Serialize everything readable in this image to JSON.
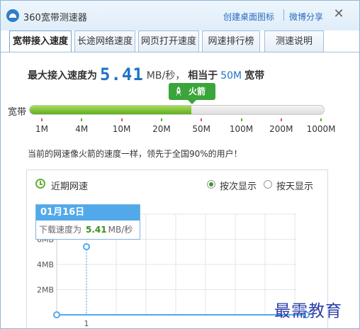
{
  "window": {
    "title": "360宽带测速器",
    "links": {
      "create_icon": "创建桌面图标",
      "share": "微博分享"
    },
    "close_icon": "close-icon"
  },
  "tabs": [
    {
      "label": "宽带接入速度",
      "active": true
    },
    {
      "label": "长途网络速度",
      "active": false
    },
    {
      "label": "网页打开速度",
      "active": false
    },
    {
      "label": "网速排行榜",
      "active": false
    },
    {
      "label": "测速说明",
      "active": false
    }
  ],
  "summary": {
    "prefix": "最大接入速度为",
    "speed": "5.41",
    "unit": "MB/秒，",
    "equiv_prefix": "相当于",
    "equiv_value": "50M",
    "equiv_suffix": "宽带"
  },
  "badge": {
    "label": "火箭",
    "icon": "rocket-icon",
    "color": "#3aa53a"
  },
  "speed_bar": {
    "label": "宽带",
    "fill_fraction": 0.55,
    "ticks": [
      "1M",
      "4M",
      "10M",
      "20M",
      "50M",
      "100M",
      "200M",
      "1000M"
    ],
    "fill_color": "#5fae1f"
  },
  "compare_text": "当前的网速像火箭的速度一样，领先于全国90%的用户！",
  "panel": {
    "title": "近期网速",
    "options": [
      {
        "label": "按次显示",
        "checked": true
      },
      {
        "label": "按天显示",
        "checked": false
      }
    ]
  },
  "chart_data": {
    "type": "line",
    "x": [
      "1"
    ],
    "series": [
      {
        "values": [
          5.41
        ]
      }
    ],
    "yticks": [
      "2MB",
      "4MB",
      "6MB"
    ],
    "ylim": [
      0,
      8
    ],
    "grid": true,
    "line_color": "#52a9ea"
  },
  "tooltip": {
    "date": "01月16日",
    "label": "下载速度为",
    "value": "5.41",
    "unit": "MB/秒"
  },
  "watermark": "最需教育"
}
